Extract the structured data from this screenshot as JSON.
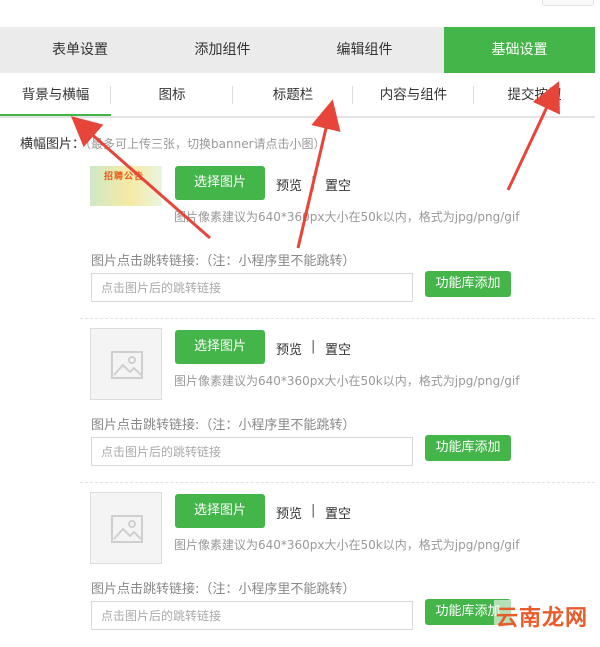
{
  "main_tabs": [
    {
      "label": "表单设置",
      "active": false
    },
    {
      "label": "添加组件",
      "active": false
    },
    {
      "label": "编辑组件",
      "active": false
    },
    {
      "label": "基础设置",
      "active": true
    }
  ],
  "sub_tabs": [
    {
      "label": "背景与横幅",
      "active": true
    },
    {
      "label": "图标",
      "active": false
    },
    {
      "label": "标题栏",
      "active": false
    },
    {
      "label": "内容与组件",
      "active": false
    },
    {
      "label": "提交按钮",
      "active": false
    }
  ],
  "banner": {
    "label": "横幅图片：",
    "hint": "（最多可上传三张，切换banner请点击小图）"
  },
  "items": [
    {
      "thumb_text": "招聘公告",
      "pick_label": "选择图片",
      "preview_label": "预览",
      "separator": "|",
      "clear_label": "置空",
      "size_hint": "图片像素建议为640*360px大小在50k以内，格式为jpg/png/gif",
      "jump_label": "图片点击跳转链接:（注：小程序里不能跳转）",
      "link_placeholder": "点击图片后的跳转链接",
      "lib_label": "功能库添加"
    },
    {
      "pick_label": "选择图片",
      "preview_label": "预览",
      "separator": "|",
      "clear_label": "置空",
      "size_hint": "图片像素建议为640*360px大小在50k以内，格式为jpg/png/gif",
      "jump_label": "图片点击跳转链接:（注：小程序里不能跳转）",
      "link_placeholder": "点击图片后的跳转链接",
      "lib_label": "功能库添加"
    },
    {
      "pick_label": "选择图片",
      "preview_label": "预览",
      "separator": "|",
      "clear_label": "置空",
      "size_hint": "图片像素建议为640*360px大小在50k以内，格式为jpg/png/gif",
      "jump_label": "图片点击跳转链接:（注：小程序里不能跳转）",
      "link_placeholder": "点击图片后的跳转链接",
      "lib_label": "功能库添加"
    }
  ],
  "watermark": "云南龙网",
  "colors": {
    "accent": "#44b549",
    "arrow": "#e8453a"
  }
}
